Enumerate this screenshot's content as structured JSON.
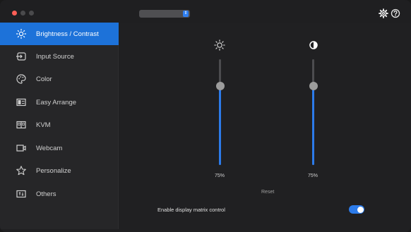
{
  "titlebar": {
    "monitor_select_value": "",
    "settings_icon": "gear-icon",
    "help_icon": "help-icon"
  },
  "sidebar": {
    "items": [
      {
        "label": "Brightness / Contrast",
        "icon": "brightness-icon",
        "active": true
      },
      {
        "label": "Input Source",
        "icon": "input-source-icon",
        "active": false
      },
      {
        "label": "Color",
        "icon": "palette-icon",
        "active": false
      },
      {
        "label": "Easy Arrange",
        "icon": "layout-icon",
        "active": false
      },
      {
        "label": "KVM",
        "icon": "kvm-icon",
        "active": false
      },
      {
        "label": "Webcam",
        "icon": "webcam-icon",
        "active": false
      },
      {
        "label": "Personalize",
        "icon": "star-icon",
        "active": false
      },
      {
        "label": "Others",
        "icon": "others-icon",
        "active": false
      }
    ]
  },
  "main": {
    "brightness": {
      "icon": "sun-icon",
      "value": 0.75,
      "value_label": "75%"
    },
    "contrast": {
      "icon": "contrast-icon",
      "value": 0.75,
      "value_label": "75%"
    },
    "reset_label": "Reset",
    "matrix_control": {
      "label": "Enable display matrix control",
      "enabled": true
    }
  },
  "colors": {
    "accent": "#1d72d9",
    "slider_fill": "#2c7bea",
    "close_dot": "#ff5f57"
  }
}
